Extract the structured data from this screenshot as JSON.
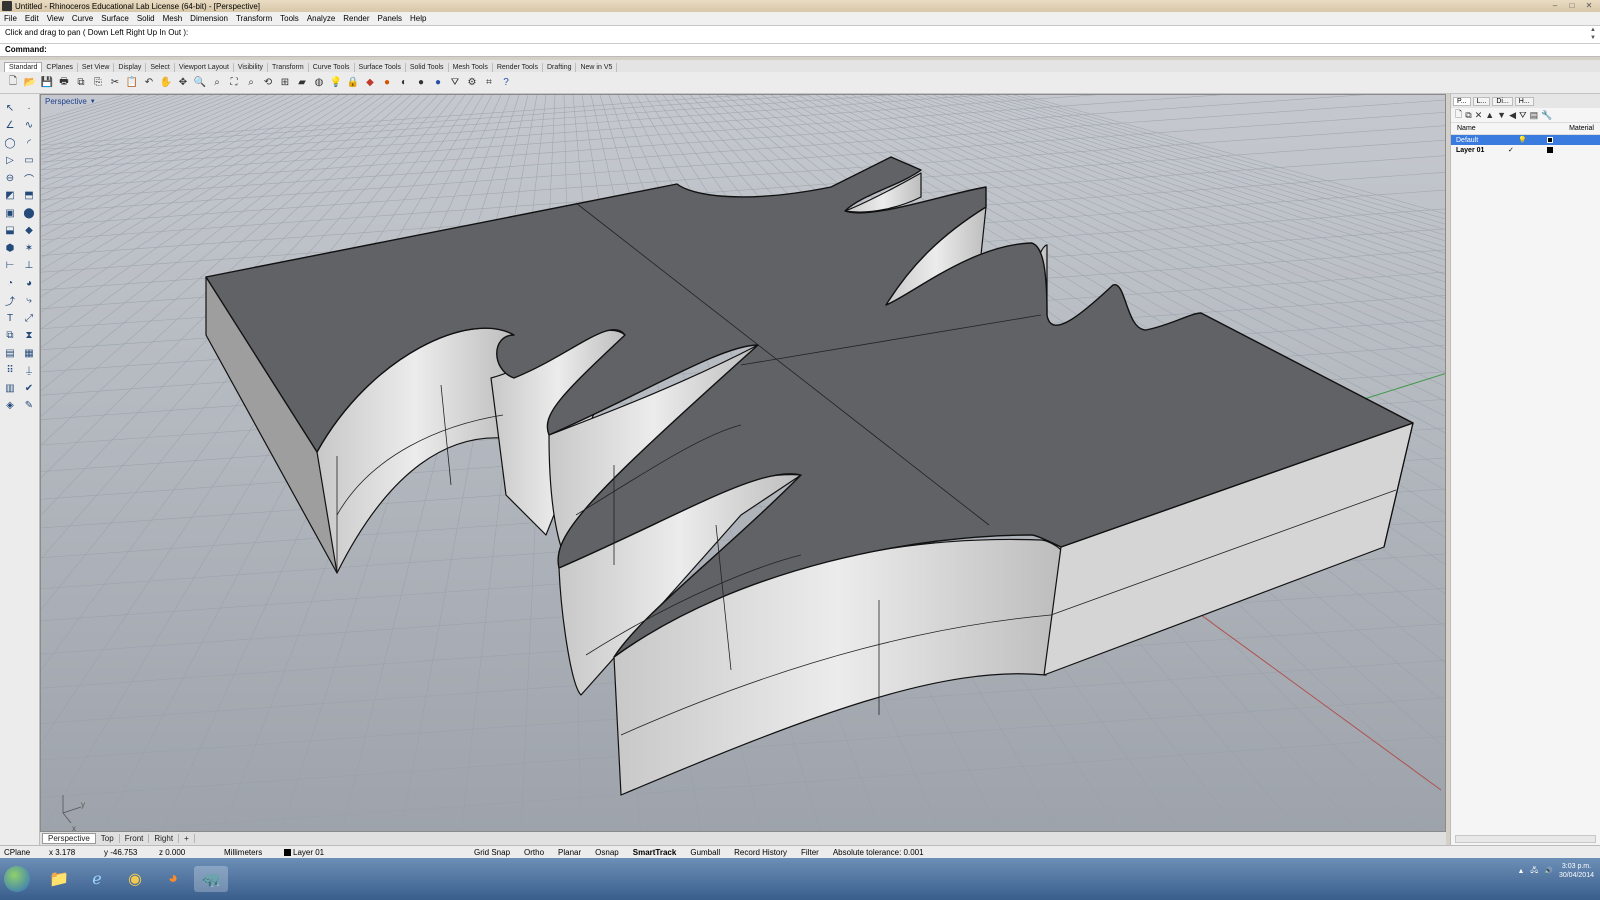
{
  "window": {
    "title": "Untitled - Rhinoceros Educational Lab License (64-bit) - [Perspective]",
    "controls": [
      "–",
      "□",
      "✕"
    ]
  },
  "menu": [
    "File",
    "Edit",
    "View",
    "Curve",
    "Surface",
    "Solid",
    "Mesh",
    "Dimension",
    "Transform",
    "Tools",
    "Analyze",
    "Render",
    "Panels",
    "Help"
  ],
  "command": {
    "history": "Click and drag to pan ( Down  Left  Right  Up  In  Out ):",
    "prompt": "Command:"
  },
  "toolbar_tabs": [
    "Standard",
    "CPlanes",
    "Set View",
    "Display",
    "Select",
    "Viewport Layout",
    "Visibility",
    "Transform",
    "Curve Tools",
    "Surface Tools",
    "Solid Tools",
    "Mesh Tools",
    "Render Tools",
    "Drafting",
    "New in V5"
  ],
  "toolbar_icons": [
    "new-icon",
    "open-icon",
    "save-icon",
    "print-icon",
    "import-icon",
    "copy-icon",
    "cut-icon",
    "paste-icon",
    "undo-icon",
    "pan-icon",
    "move-icon",
    "zoom-icon",
    "zoom-window-icon",
    "zoom-extents-icon",
    "zoom-selected-icon",
    "rotate-view-icon",
    "four-view-icon",
    "cplane-icon",
    "shade-icon",
    "light-icon",
    "lock-icon",
    "layer-icon",
    "sphere-icon",
    "material-icon",
    "render-icon",
    "env-icon",
    "filter-icon",
    "options-icon",
    "snap-icon",
    "help-icon"
  ],
  "viewport": {
    "name": "Perspective",
    "tabs": [
      "Perspective",
      "Top",
      "Front",
      "Right",
      "+"
    ],
    "active_tab": "Perspective",
    "axis_labels": {
      "y": "y",
      "x": "x"
    }
  },
  "panel": {
    "tabs": [
      "P...",
      "L...",
      "Di...",
      "H..."
    ],
    "columns": {
      "name": "Name",
      "material": "Material"
    },
    "layers": [
      {
        "name": "Default",
        "current": "",
        "selected": true
      },
      {
        "name": "Layer 01",
        "current": "✓",
        "selected": false
      }
    ]
  },
  "status": {
    "cplane": "CPlane",
    "x": "x 3.178",
    "y": "y -46.753",
    "z": "z 0.000",
    "units": "Millimeters",
    "layer": "Layer 01",
    "toggles": [
      "Grid Snap",
      "Ortho",
      "Planar",
      "Osnap",
      "SmartTrack",
      "Gumball",
      "Record History",
      "Filter"
    ],
    "active_toggle": "SmartTrack",
    "tolerance": "Absolute tolerance: 0.001"
  },
  "taskbar": {
    "time": "3:03 p.m.",
    "date": "30/04/2014"
  },
  "colors": {
    "viewport_bg": "#b2b7bf",
    "top_face": "#616266",
    "side_face": "#d9d9d9",
    "edge": "#111111",
    "x_axis": "#b05050",
    "y_axis": "#3f9a4a"
  }
}
